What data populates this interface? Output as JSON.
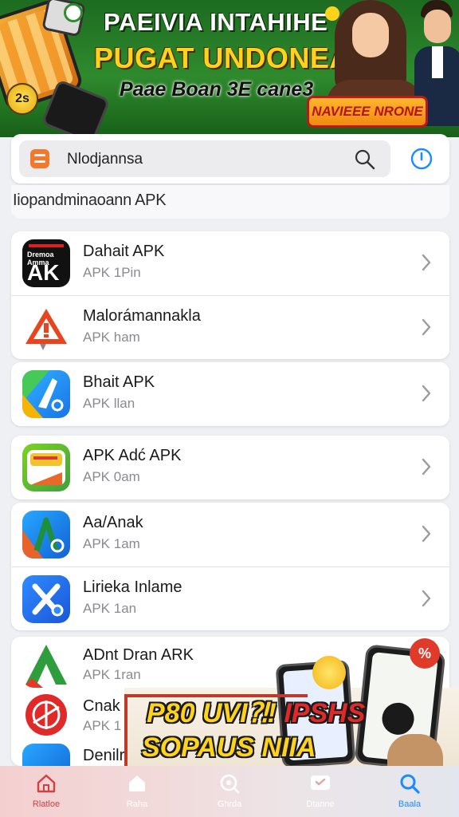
{
  "banner": {
    "line1": "PAEIVIA INTAHIHE",
    "line2": "PUGAT UNDONEAI!",
    "line3": "Paae Boan 3E cane3",
    "badge": "NAVIEEE NRONE",
    "coin_label": "2s"
  },
  "search": {
    "value": "Nlodjannsa",
    "logo_icon": "app-logo-icon",
    "search_icon": "search-icon",
    "history_icon": "clock-icon"
  },
  "suggestion": {
    "text": "Iiopandminaoann APK"
  },
  "apps": [
    {
      "title": "Dahait APK",
      "subtitle": "APK 1Pin",
      "icon": "ak-app-icon",
      "icon_text_small": "Dremoa Amma",
      "icon_text_big": "AK"
    },
    {
      "title": "Malorámannakla",
      "subtitle": "APK ham",
      "icon": "warning-app-icon"
    },
    {
      "title": "Bhait APK",
      "subtitle": "APK llan",
      "icon": "blue-pen-app-icon"
    },
    {
      "title": "APK Adć APK",
      "subtitle": "APK 0am",
      "icon": "green-tile-app-icon"
    },
    {
      "title": "Aa/Anak",
      "subtitle": "APK 1am",
      "icon": "a-letter-app-icon"
    },
    {
      "title": "Lirieka Inlame",
      "subtitle": "APK 1an",
      "icon": "x-letter-app-icon"
    },
    {
      "title": "ADnt Dran ARK",
      "subtitle": "APK 1ran",
      "icon": "green-app-icon"
    },
    {
      "title": "Cnak I",
      "subtitle": "APK 1",
      "icon": "red-circle-app-icon"
    },
    {
      "title": "Denilr",
      "subtitle": "",
      "icon": "blue-app-icon"
    }
  ],
  "promo": {
    "line1": "P80 UVI⁈!",
    "line1_red": "IPSHS",
    "line2": "SOPAUS NIIA",
    "badge": "%"
  },
  "tabs": [
    {
      "label": "Rlatloe",
      "icon": "home-outline-icon"
    },
    {
      "label": "Raha",
      "icon": "home-icon"
    },
    {
      "label": "Ghrda",
      "icon": "discover-icon"
    },
    {
      "label": "Dtanne",
      "icon": "messages-icon"
    },
    {
      "label": "Baala",
      "icon": "search-icon"
    }
  ],
  "colors": {
    "accent": "#1a8cff",
    "banner_green": "#2f8a2d",
    "banner_yellow": "#ffd21c",
    "badge_red": "#b81414"
  }
}
